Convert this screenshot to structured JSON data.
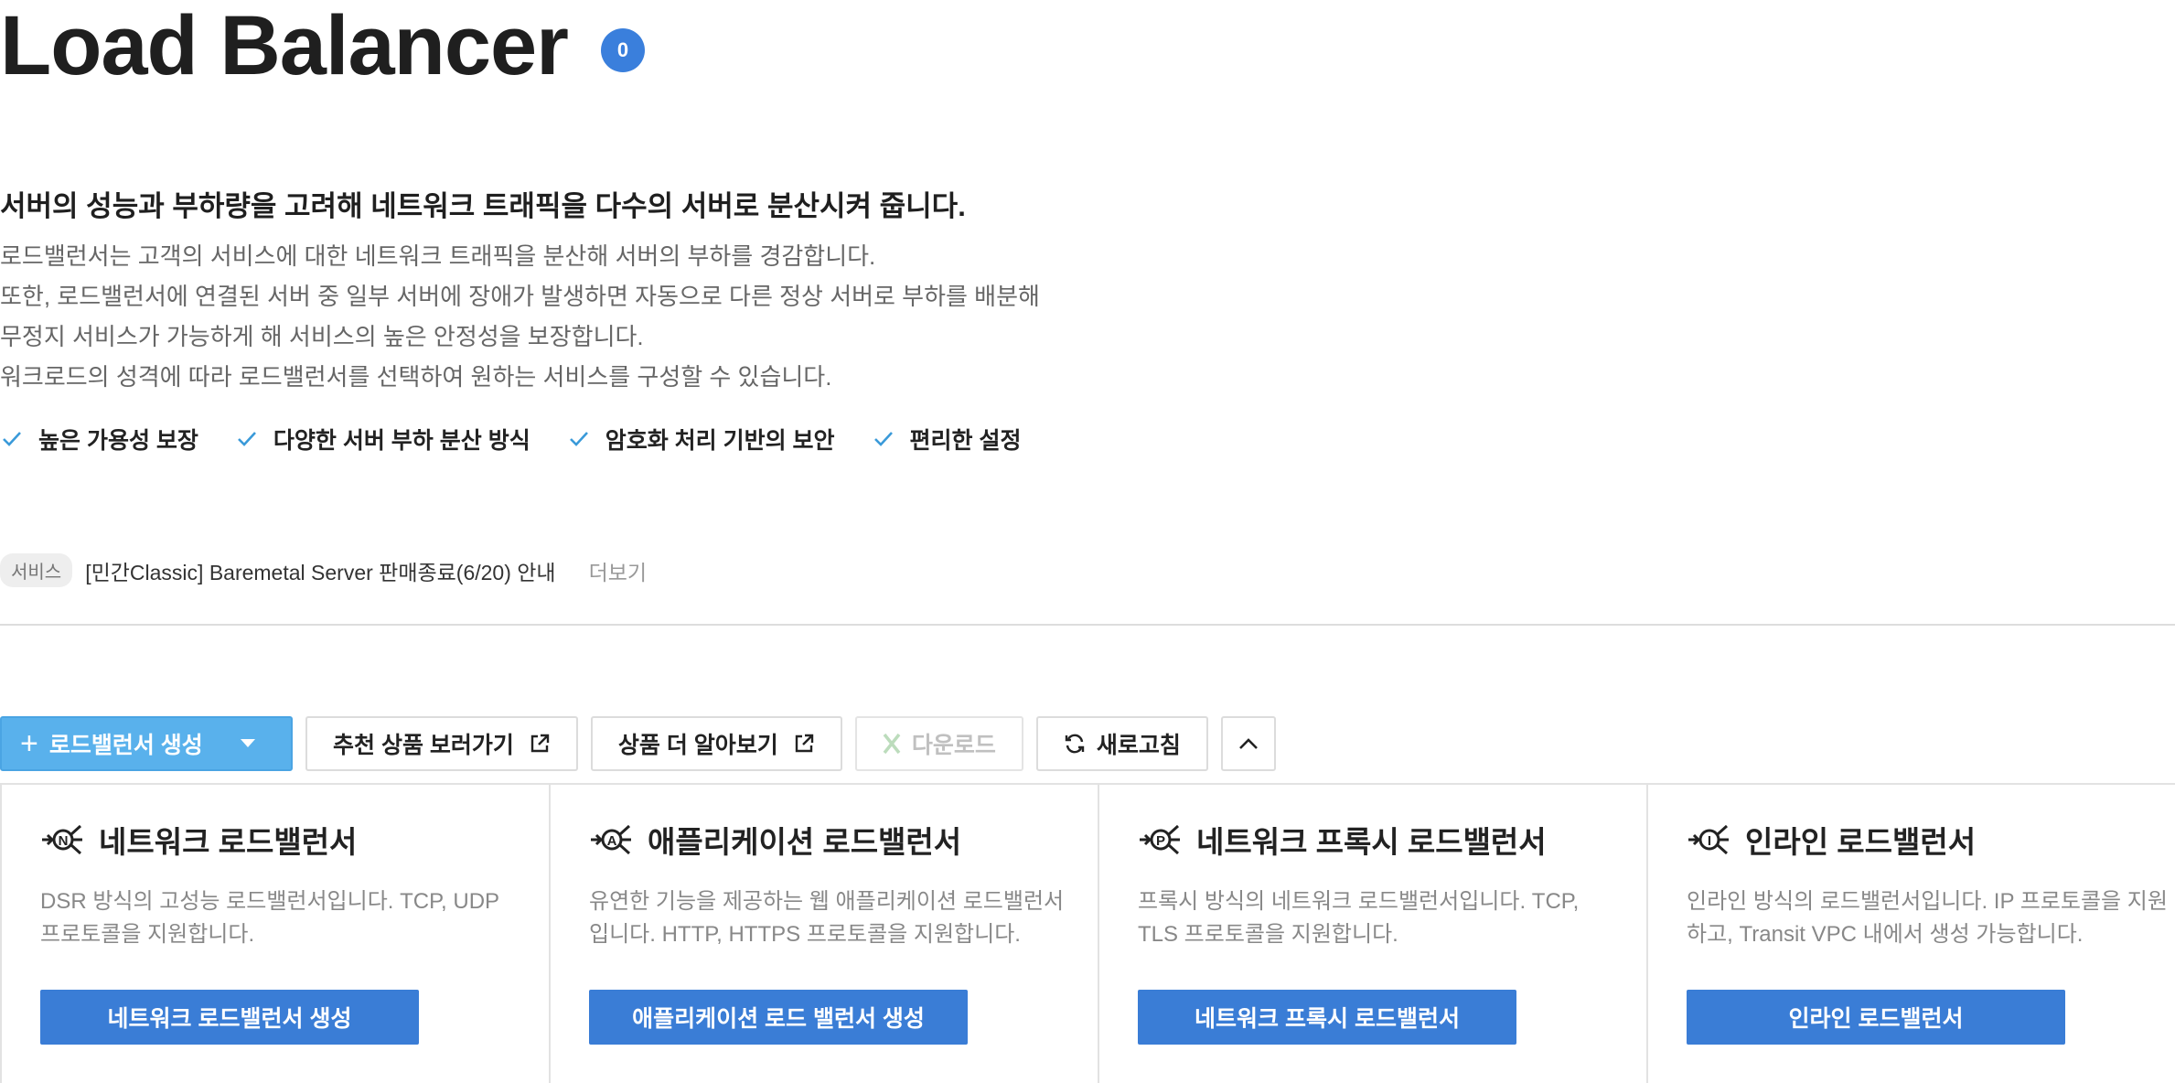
{
  "header": {
    "title": "Load Balancer",
    "count": "0"
  },
  "intro": {
    "headline": "서버의 성능과 부하량을 고려해 네트워크 트래픽을 다수의 서버로 분산시켜 줍니다.",
    "lines": [
      "로드밸런서는 고객의 서비스에 대한 네트워크 트래픽을 분산해 서버의 부하를 경감합니다.",
      "또한, 로드밸런서에 연결된 서버 중 일부 서버에 장애가 발생하면 자동으로 다른 정상 서버로 부하를 배분해",
      "무정지 서비스가 가능하게 해 서비스의 높은 안정성을 보장합니다.",
      "워크로드의 성격에 따라 로드밸런서를 선택하여 원하는 서비스를 구성할 수 있습니다."
    ]
  },
  "features": [
    {
      "label": "높은 가용성 보장",
      "icon": "check-icon"
    },
    {
      "label": "다양한 서버 부하 분산 방식",
      "icon": "check-icon"
    },
    {
      "label": "암호화 처리 기반의 보안",
      "icon": "check-icon"
    },
    {
      "label": "편리한 설정",
      "icon": "check-icon"
    }
  ],
  "notice": {
    "tag": "서비스",
    "text": "[민간Classic] Baremetal Server 판매종료(6/20) 안내",
    "more": "더보기"
  },
  "toolbar": {
    "create_label": "로드밸런서 생성",
    "recommended_label": "추천 상품 보러가기",
    "learn_more_label": "상품 더 알아보기",
    "download_label": "다운로드",
    "refresh_label": "새로고침"
  },
  "cards": [
    {
      "icon_letter": "N",
      "title": "네트워크 로드밸런서",
      "desc": "DSR 방식의 고성능 로드밸런서입니다. TCP, UDP 프로토콜을 지원합니다.",
      "button": "네트워크 로드밸런서 생성"
    },
    {
      "icon_letter": "A",
      "title": "애플리케이션 로드밸런서",
      "desc": "유연한 기능을 제공하는 웹 애플리케이션 로드밸런서입니다. HTTP, HTTPS 프로토콜을 지원합니다.",
      "button": "애플리케이션 로드 밸런서 생성"
    },
    {
      "icon_letter": "P",
      "title": "네트워크 프록시 로드밸런서",
      "desc": "프록시 방식의 네트워크 로드밸런서입니다. TCP, TLS 프로토콜을 지원합니다.",
      "button": "네트워크 프록시 로드밸런서"
    },
    {
      "icon_letter": "I",
      "title": "인라인 로드밸런서",
      "desc": "인라인 방식의 로드밸런서입니다. IP 프로토콜을 지원하고, Transit VPC 내에서 생성 가능합니다.",
      "button": "인라인 로드밸런서"
    }
  ],
  "colors": {
    "primary": "#59b1ec",
    "card_button": "#3a7dd6",
    "badge": "#3a7fdc",
    "check": "#3a9ad9"
  }
}
